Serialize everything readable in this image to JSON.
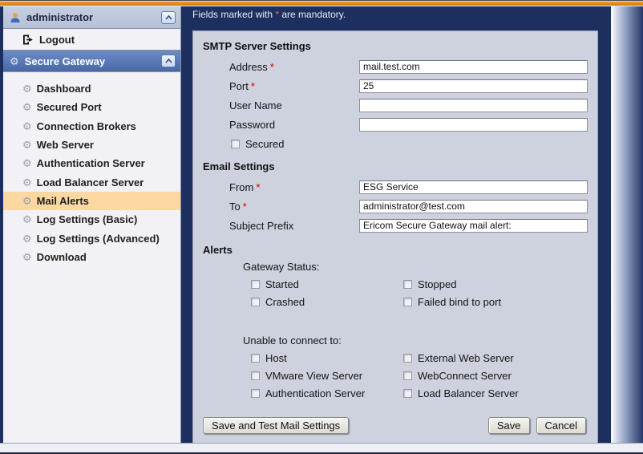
{
  "colors": {
    "topbar_orange": "#e0891c",
    "navy_background": "#1c2f5f",
    "panel_background": "#cdd2de",
    "sidebar_background": "#f2f2f6",
    "user_header_background": "#b6c1d7",
    "gateway_header_background": "#5878b6",
    "selected_item_background": "#fbd8a2",
    "required_asterisk_red": "#cc0000"
  },
  "sidebar": {
    "user_header": {
      "label": "administrator"
    },
    "logout": {
      "label": "Logout"
    },
    "gateway_header": {
      "label": "Secure Gateway"
    },
    "items": [
      {
        "label": "Dashboard"
      },
      {
        "label": "Secured Port"
      },
      {
        "label": "Connection Brokers"
      },
      {
        "label": "Web Server"
      },
      {
        "label": "Authentication Server"
      },
      {
        "label": "Load Balancer Server"
      },
      {
        "label": "Mail Alerts",
        "selected": true
      },
      {
        "label": "Log Settings (Basic)"
      },
      {
        "label": "Log Settings (Advanced)"
      },
      {
        "label": "Download"
      }
    ]
  },
  "main": {
    "mandatory_note": {
      "prefix": "Fields marked with ",
      "asterisk": "*",
      "suffix": " are mandatory."
    },
    "asterisk": "*",
    "smtp": {
      "heading": "SMTP Server Settings",
      "address": {
        "label": "Address",
        "required": true,
        "value": "mail.test.com"
      },
      "port": {
        "label": "Port",
        "required": true,
        "value": "25"
      },
      "username": {
        "label": "User Name",
        "required": false,
        "value": ""
      },
      "password": {
        "label": "Password",
        "required": false,
        "value": ""
      },
      "secured": {
        "label": "Secured",
        "checked": false
      }
    },
    "email": {
      "heading": "Email Settings",
      "from": {
        "label": "From",
        "required": true,
        "value": "ESG Service"
      },
      "to": {
        "label": "To",
        "required": true,
        "value": "administrator@test.com"
      },
      "subject_prefix": {
        "label": "Subject Prefix",
        "required": false,
        "value": "Ericom Secure Gateway mail alert:"
      }
    },
    "alerts": {
      "heading": "Alerts",
      "gateway_status": {
        "label": "Gateway Status:",
        "options": [
          "Started",
          "Stopped",
          "Crashed",
          "Failed bind to port"
        ]
      },
      "unable_to_connect": {
        "label": "Unable to connect to:",
        "options": [
          "Host",
          "External Web Server",
          "VMware View Server",
          "WebConnect Server",
          "Authentication Server",
          "Load Balancer Server"
        ]
      }
    },
    "buttons": {
      "save_and_test": "Save and Test Mail Settings",
      "save": "Save",
      "cancel": "Cancel"
    }
  }
}
